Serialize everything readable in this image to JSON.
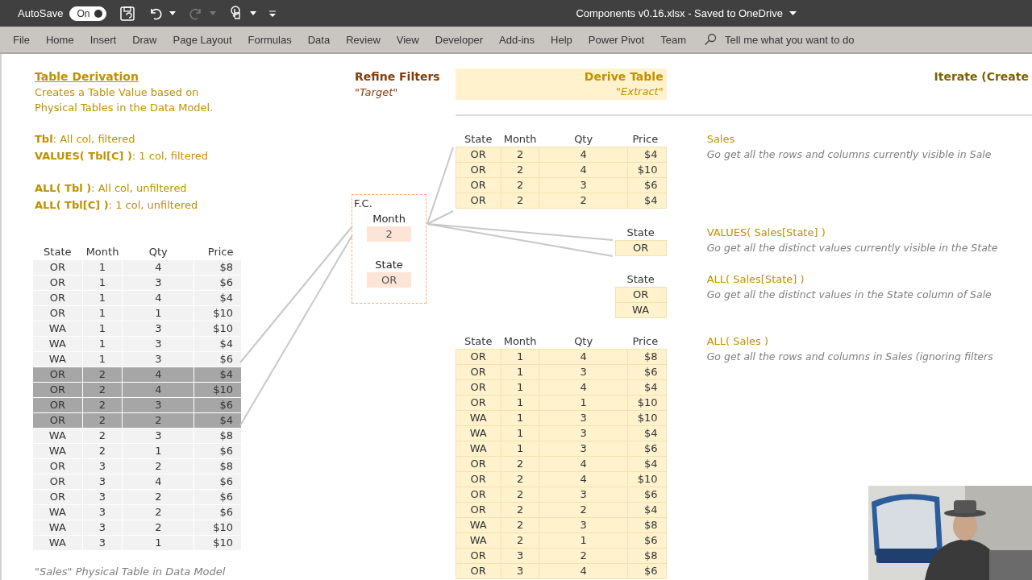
{
  "title_bar": {
    "autosave_label": "AutoSave",
    "autosave": {
      "on": true,
      "text": "On"
    },
    "document_title": "Components v0.16.xlsx  -  Saved to OneDrive"
  },
  "ribbon": {
    "tabs": [
      {
        "label": "File",
        "selected": false
      },
      {
        "label": "Home",
        "selected": false
      },
      {
        "label": "Insert",
        "selected": false
      },
      {
        "label": "Draw",
        "selected": false
      },
      {
        "label": "Page Layout",
        "selected": false
      },
      {
        "label": "Formulas",
        "selected": false
      },
      {
        "label": "Data",
        "selected": false
      },
      {
        "label": "Review",
        "selected": false
      },
      {
        "label": "View",
        "selected": false
      },
      {
        "label": "Developer",
        "selected": false
      },
      {
        "label": "Add-ins",
        "selected": false
      },
      {
        "label": "Help",
        "selected": false
      },
      {
        "label": "Power Pivot",
        "selected": false
      },
      {
        "label": "Team",
        "selected": false
      }
    ],
    "search": {
      "placeholder": "Tell me what you want to do"
    }
  },
  "sheet": {
    "derivation": {
      "title": "Table Derivation",
      "description_lines": [
        "Creates a Table Value based on",
        "Physical Tables in the Data Model."
      ],
      "notes": [
        [
          "**Tbl**: All col, filtered",
          "**VALUES( Tbl[C] )**: 1 col, filtered"
        ],
        [
          "**ALL( Tbl )**: All col, unfiltered",
          "**ALL( Tbl[C] )**: 1 col, unfiltered"
        ]
      ]
    },
    "source_table": {
      "columns": [
        "State",
        "Month",
        "Qty",
        "Price"
      ],
      "rows": [
        {
          "cells": [
            "OR",
            "1",
            "4",
            "$8"
          ],
          "highlighted": false
        },
        {
          "cells": [
            "OR",
            "1",
            "3",
            "$6"
          ],
          "highlighted": false
        },
        {
          "cells": [
            "OR",
            "1",
            "4",
            "$4"
          ],
          "highlighted": false
        },
        {
          "cells": [
            "OR",
            "1",
            "1",
            "$10"
          ],
          "highlighted": false
        },
        {
          "cells": [
            "WA",
            "1",
            "3",
            "$10"
          ],
          "highlighted": false
        },
        {
          "cells": [
            "WA",
            "1",
            "3",
            "$4"
          ],
          "highlighted": false
        },
        {
          "cells": [
            "WA",
            "1",
            "3",
            "$6"
          ],
          "highlighted": false
        },
        {
          "cells": [
            "OR",
            "2",
            "4",
            "$4"
          ],
          "highlighted": true
        },
        {
          "cells": [
            "OR",
            "2",
            "4",
            "$10"
          ],
          "highlighted": true
        },
        {
          "cells": [
            "OR",
            "2",
            "3",
            "$6"
          ],
          "highlighted": true
        },
        {
          "cells": [
            "OR",
            "2",
            "2",
            "$4"
          ],
          "highlighted": true
        },
        {
          "cells": [
            "WA",
            "2",
            "3",
            "$8"
          ],
          "highlighted": false
        },
        {
          "cells": [
            "WA",
            "2",
            "1",
            "$6"
          ],
          "highlighted": false
        },
        {
          "cells": [
            "OR",
            "3",
            "2",
            "$8"
          ],
          "highlighted": false
        },
        {
          "cells": [
            "OR",
            "3",
            "4",
            "$6"
          ],
          "highlighted": false
        },
        {
          "cells": [
            "OR",
            "3",
            "2",
            "$6"
          ],
          "highlighted": false
        },
        {
          "cells": [
            "WA",
            "3",
            "2",
            "$6"
          ],
          "highlighted": false
        },
        {
          "cells": [
            "WA",
            "3",
            "2",
            "$10"
          ],
          "highlighted": false
        },
        {
          "cells": [
            "WA",
            "3",
            "1",
            "$10"
          ],
          "highlighted": false
        }
      ],
      "caption": "\"Sales\" Physical Table in Data Model"
    },
    "refine": {
      "title": "Refine Filters",
      "subtitle": "\"Target\"",
      "filter_context": {
        "label": "F.C.",
        "fields": [
          {
            "name": "Month",
            "value": "2"
          },
          {
            "name": "State",
            "value": "OR"
          }
        ]
      }
    },
    "derive": {
      "title": "Derive Table",
      "subtitle": "\"Extract\""
    },
    "iterate": {
      "title": "Iterate (Create"
    },
    "results": [
      {
        "kind": "table",
        "columns": [
          "State",
          "Month",
          "Qty",
          "Price"
        ],
        "rows": [
          [
            "OR",
            "2",
            "4",
            "$4"
          ],
          [
            "OR",
            "2",
            "4",
            "$10"
          ],
          [
            "OR",
            "2",
            "3",
            "$6"
          ],
          [
            "OR",
            "2",
            "2",
            "$4"
          ]
        ],
        "expression": "Sales",
        "description": "Go get all the rows and columns currently visible in Sale"
      },
      {
        "kind": "column",
        "columns": [
          "State"
        ],
        "rows": [
          [
            "OR"
          ]
        ],
        "expression": "VALUES( Sales[State] )",
        "description": "Go get all the distinct values currently visible in the State"
      },
      {
        "kind": "column",
        "columns": [
          "State"
        ],
        "rows": [
          [
            "OR"
          ],
          [
            "WA"
          ]
        ],
        "expression": "ALL( Sales[State] )",
        "description": "Go get all the distinct values in the State column of Sale"
      },
      {
        "kind": "table",
        "columns": [
          "State",
          "Month",
          "Qty",
          "Price"
        ],
        "rows": [
          [
            "OR",
            "1",
            "4",
            "$8"
          ],
          [
            "OR",
            "1",
            "3",
            "$6"
          ],
          [
            "OR",
            "1",
            "4",
            "$4"
          ],
          [
            "OR",
            "1",
            "1",
            "$10"
          ],
          [
            "WA",
            "1",
            "3",
            "$10"
          ],
          [
            "WA",
            "1",
            "3",
            "$4"
          ],
          [
            "WA",
            "1",
            "3",
            "$6"
          ],
          [
            "OR",
            "2",
            "4",
            "$4"
          ],
          [
            "OR",
            "2",
            "4",
            "$10"
          ],
          [
            "OR",
            "2",
            "3",
            "$6"
          ],
          [
            "OR",
            "2",
            "2",
            "$4"
          ],
          [
            "WA",
            "2",
            "3",
            "$8"
          ],
          [
            "WA",
            "2",
            "1",
            "$6"
          ],
          [
            "OR",
            "3",
            "2",
            "$8"
          ],
          [
            "OR",
            "3",
            "4",
            "$6"
          ]
        ],
        "expression": "ALL( Sales )",
        "description": "Go get all the rows and columns in Sales (ignoring filters"
      }
    ]
  }
}
